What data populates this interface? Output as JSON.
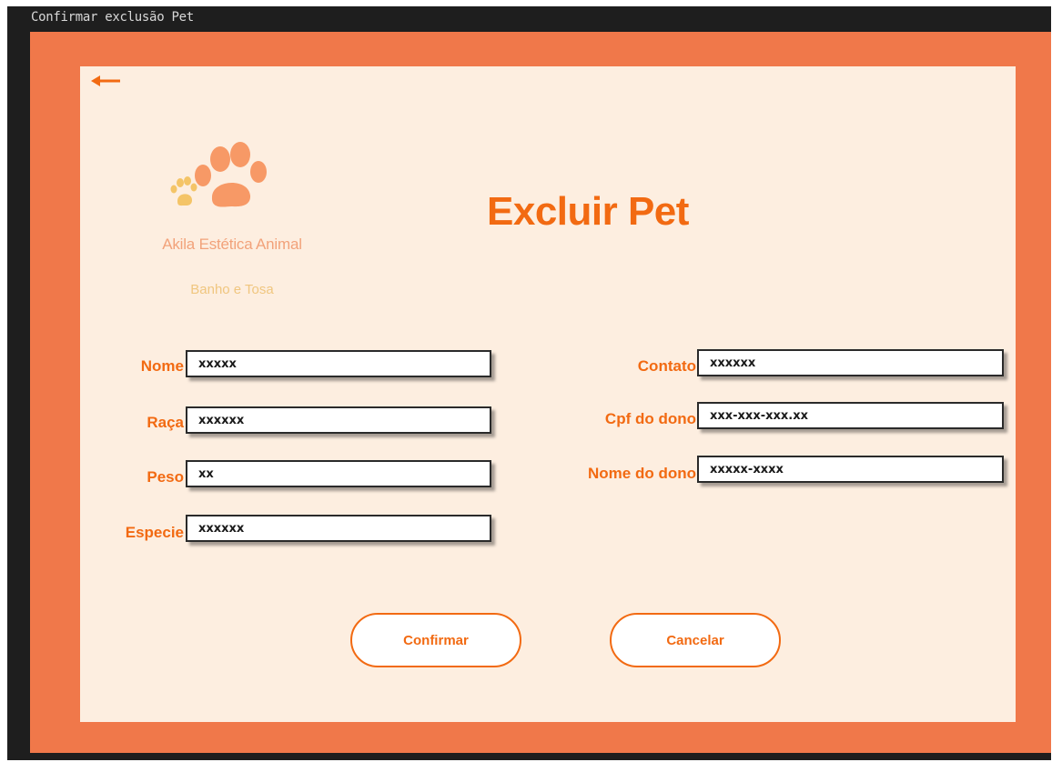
{
  "window": {
    "title": "Confirmar exclusão Pet"
  },
  "brand": {
    "name": "Akila Estética  Animal",
    "tagline": "Banho e Tosa"
  },
  "page": {
    "heading": "Excluir Pet"
  },
  "form": {
    "left": [
      {
        "label": "Nome",
        "value": "xxxxx"
      },
      {
        "label": "Raça",
        "value": "xxxxxx"
      },
      {
        "label": "Peso",
        "value": "xx"
      },
      {
        "label": "Especie",
        "value": "xxxxxx"
      }
    ],
    "right": [
      {
        "label": "Contato",
        "value": "xxxxxx"
      },
      {
        "label": "Cpf do dono",
        "value": "xxx-xxx-xxx.xx"
      },
      {
        "label": "Nome do dono",
        "value": "xxxxx-xxxx"
      }
    ]
  },
  "actions": {
    "confirm": "Confirmar",
    "cancel": "Cancelar"
  },
  "colors": {
    "accent": "#f26a12",
    "panel": "#f0784a",
    "background": "#fdeee0",
    "frame": "#1e1e1e",
    "paw_large": "#f79966",
    "paw_small": "#f4c467"
  },
  "icons": {
    "back": "arrow-left-icon",
    "logo": "paw-print-icon"
  }
}
